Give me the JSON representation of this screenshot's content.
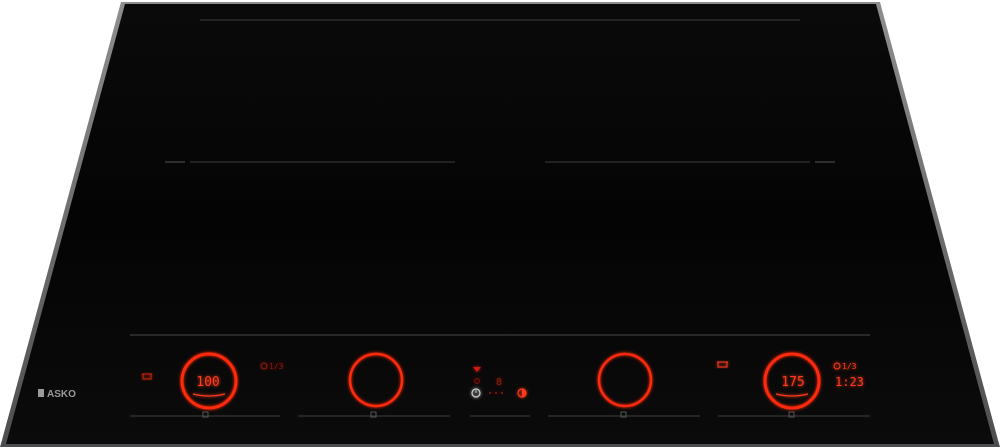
{
  "brand": {
    "logo_text": "ASKO"
  },
  "colors": {
    "glass": "#050505",
    "frame": "#6a6c6e",
    "led_red": "#ff2a10",
    "led_dim": "#8a1a0e",
    "line": "#2a2a2a"
  },
  "zones": [
    {
      "id": "front-left",
      "display": "100",
      "ring_lit": true,
      "timer_text": "",
      "timer_icon_lit": false
    },
    {
      "id": "front-middle-left",
      "display": "",
      "ring_lit": true
    },
    {
      "id": "front-middle-right",
      "display": "",
      "ring_lit": true
    },
    {
      "id": "front-right",
      "display": "175",
      "ring_lit": true,
      "timer_text": "1:23",
      "timer_icon_lit": true
    }
  ],
  "center_panel": {
    "digit_display": "8"
  },
  "icons": [
    "pot-icon-left",
    "timer-icon-left",
    "wifi-icon",
    "power-icon",
    "clock-icon",
    "half-circle-icon",
    "pot-icon-right",
    "timer-icon-right",
    "zone-marker-icon"
  ]
}
